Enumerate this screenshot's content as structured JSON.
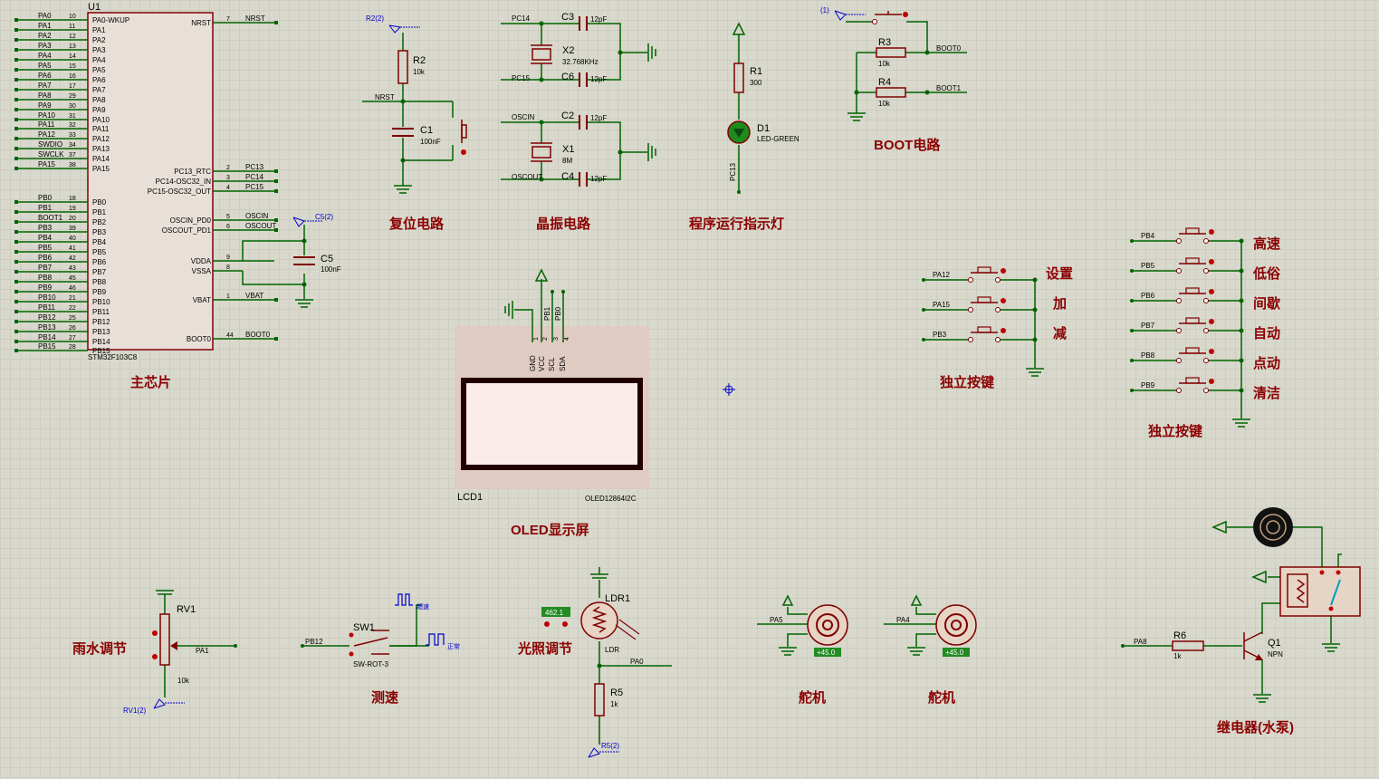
{
  "colors": {
    "background": "#d8d8cc",
    "grid": "#c4c4b8",
    "wire": "#006400",
    "component": "#800000",
    "label": "#000000",
    "heading": "#8b0000",
    "blue": "#0000cc"
  },
  "mcu": {
    "ref": "U1",
    "part": "STM32F103C8",
    "left_pins": [
      {
        "net": "PA0",
        "num": "10",
        "name": "PA0-WKUP"
      },
      {
        "net": "PA1",
        "num": "11",
        "name": "PA1"
      },
      {
        "net": "PA2",
        "num": "12",
        "name": "PA2"
      },
      {
        "net": "PA3",
        "num": "13",
        "name": "PA3"
      },
      {
        "net": "PA4",
        "num": "14",
        "name": "PA4"
      },
      {
        "net": "PA5",
        "num": "15",
        "name": "PA5"
      },
      {
        "net": "PA6",
        "num": "16",
        "name": "PA6"
      },
      {
        "net": "PA7",
        "num": "17",
        "name": "PA7"
      },
      {
        "net": "PA8",
        "num": "29",
        "name": "PA8"
      },
      {
        "net": "PA9",
        "num": "30",
        "name": "PA9"
      },
      {
        "net": "PA10",
        "num": "31",
        "name": "PA10"
      },
      {
        "net": "PA11",
        "num": "32",
        "name": "PA11"
      },
      {
        "net": "PA12",
        "num": "33",
        "name": "PA12"
      },
      {
        "net": "SWDIO",
        "num": "34",
        "name": "PA13"
      },
      {
        "net": "SWCLK",
        "num": "37",
        "name": "PA14"
      },
      {
        "net": "PA15",
        "num": "38",
        "name": "PA15"
      },
      {
        "net": "PB0",
        "num": "18",
        "name": "PB0"
      },
      {
        "net": "PB1",
        "num": "19",
        "name": "PB1"
      },
      {
        "net": "BOOT1",
        "num": "20",
        "name": "PB2"
      },
      {
        "net": "PB3",
        "num": "39",
        "name": "PB3"
      },
      {
        "net": "PB4",
        "num": "40",
        "name": "PB4"
      },
      {
        "net": "PB5",
        "num": "41",
        "name": "PB5"
      },
      {
        "net": "PB6",
        "num": "42",
        "name": "PB6"
      },
      {
        "net": "PB7",
        "num": "43",
        "name": "PB7"
      },
      {
        "net": "PB8",
        "num": "45",
        "name": "PB8"
      },
      {
        "net": "PB9",
        "num": "46",
        "name": "PB9"
      },
      {
        "net": "PB10",
        "num": "21",
        "name": "PB10"
      },
      {
        "net": "PB11",
        "num": "22",
        "name": "PB11"
      },
      {
        "net": "PB12",
        "num": "25",
        "name": "PB12"
      },
      {
        "net": "PB13",
        "num": "26",
        "name": "PB13"
      },
      {
        "net": "PB14",
        "num": "27",
        "name": "PB14"
      },
      {
        "net": "PB15",
        "num": "28",
        "name": "PB15"
      }
    ],
    "right_pins": [
      {
        "name": "NRST",
        "num": "7",
        "net": "NRST"
      },
      {
        "name": "PC13_RTC",
        "num": "2",
        "net": "PC13"
      },
      {
        "name": "PC14-OSC32_IN",
        "num": "3",
        "net": "PC14"
      },
      {
        "name": "PC15-OSC32_OUT",
        "num": "4",
        "net": "PC15"
      },
      {
        "name": "OSCIN_PD0",
        "num": "5",
        "net": "OSCIN"
      },
      {
        "name": "OSCOUT_PD1",
        "num": "6",
        "net": "OSCOUT"
      },
      {
        "name": "VDDA",
        "num": "9",
        "net": ""
      },
      {
        "name": "VSSA",
        "num": "8",
        "net": ""
      },
      {
        "name": "VBAT",
        "num": "1",
        "net": "VBAT"
      },
      {
        "name": "BOOT0",
        "num": "44",
        "net": "BOOT0"
      }
    ],
    "c5": {
      "ref": "C5",
      "value": "100nF",
      "probe": "C5(2)"
    }
  },
  "headings": {
    "mcu": "主芯片",
    "reset": "复位电路",
    "crystal": "晶振电路",
    "led": "程序运行指示灯",
    "boot": "BOOT电路",
    "oled": "OLED显示屏",
    "keys1": "独立按键",
    "keys2": "独立按键",
    "rain": "雨水调节",
    "speed": "测速",
    "light": "光照调节",
    "servo1": "舵机",
    "servo2": "舵机",
    "relay": "继电器(水泵)"
  },
  "reset": {
    "r_ref": "R2",
    "r_val": "10k",
    "probe": "R2(2)",
    "net": "NRST",
    "c_ref": "C1",
    "c_val": "100nF"
  },
  "crystal": {
    "nets": [
      "PC14",
      "PC15",
      "OSCIN",
      "OSCOUT"
    ],
    "c3": "C3",
    "c6": "C6",
    "c2": "C2",
    "c4": "C4",
    "cap_val": "12pF",
    "x2": "X2",
    "x2_val": "32.768KHz",
    "x1": "X1",
    "x1_val": "8M"
  },
  "led": {
    "r_ref": "R1",
    "r_val": "300",
    "d_ref": "D1",
    "d_val": "LED-GREEN",
    "net": "PC13"
  },
  "boot": {
    "probe": "(1)",
    "r3": "R3",
    "r3_val": "10k",
    "r4": "R4",
    "r4_val": "10k",
    "net0": "BOOT0",
    "net1": "BOOT1"
  },
  "oled": {
    "ref": "LCD1",
    "part": "OLED12864I2C",
    "pins": [
      "GND",
      "VCC",
      "SCL",
      "SDA"
    ],
    "pin_nums": [
      "1",
      "2",
      "3",
      "4"
    ],
    "nets": [
      "PB1",
      "PB0"
    ]
  },
  "keys1": {
    "nets": [
      "PA12",
      "PA15",
      "PB3"
    ],
    "labels": [
      "设置",
      "加",
      "减"
    ]
  },
  "keys2": {
    "nets": [
      "PB4",
      "PB5",
      "PB6",
      "PB7",
      "PB8",
      "PB9"
    ],
    "labels": [
      "高速",
      "低俗",
      "间歇",
      "自动",
      "点动",
      "清洁"
    ]
  },
  "rain": {
    "ref": "RV1",
    "value": "10k",
    "net": "PA1",
    "probe": "RV1(2)"
  },
  "speed": {
    "ref": "SW1",
    "part": "SW-ROT-3",
    "net": "PB12",
    "high": "超速",
    "normal": "正常"
  },
  "light": {
    "ref": "LDR1",
    "part": "LDR",
    "reading": "462.1",
    "net": "PA0",
    "r_ref": "R5",
    "r_val": "1k",
    "probe": "R5(2)"
  },
  "servo1": {
    "net": "PA5",
    "reading": "+45.0"
  },
  "servo2": {
    "net": "PA4",
    "reading": "+45.0"
  },
  "relay": {
    "net": "PA8",
    "r_ref": "R6",
    "r_val": "1k",
    "q_ref": "Q1",
    "q_part": "NPN"
  }
}
